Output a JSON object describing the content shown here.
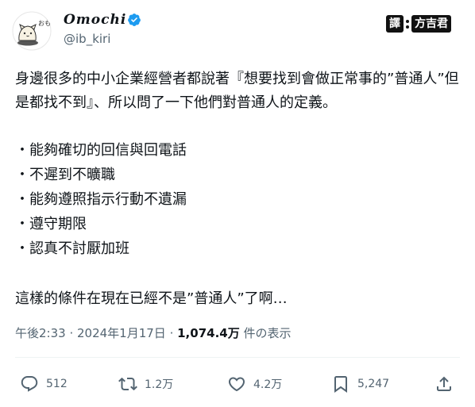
{
  "author": {
    "display_name": "Omochi",
    "handle": "@ib_kiri",
    "verified": true,
    "avatar_text": "おもち"
  },
  "translator_badge": {
    "left_text": "譯",
    "right_text": "方吉君"
  },
  "tweet": {
    "intro": "身邊很多的中小企業經營者都說著『想要找到會做正常事的”普通人”但是都找不到』、所以問了一下他們對普通人的定義。",
    "bullets": [
      "・能夠確切的回信與回電話",
      "・不遲到不曠職",
      "・能夠遵照指示行動不遺漏",
      "・遵守期限",
      "・認真不討厭加班"
    ],
    "closing": "這樣的條件在現在已經不是”普通人”了啊…"
  },
  "meta": {
    "time": "午後2:33",
    "separator": " · ",
    "date": "2024年1月17日",
    "separator2": " · ",
    "views_count": "1,074.4万",
    "views_label": " 件の表示"
  },
  "actions": {
    "reply_count": "512",
    "retweet_count": "1.2万",
    "like_count": "4.2万",
    "bookmark_count": "5,247"
  },
  "colors": {
    "text": "#0f1419",
    "secondary": "#536471",
    "verified": "#1d9bf0",
    "divider": "#eff3f4"
  }
}
